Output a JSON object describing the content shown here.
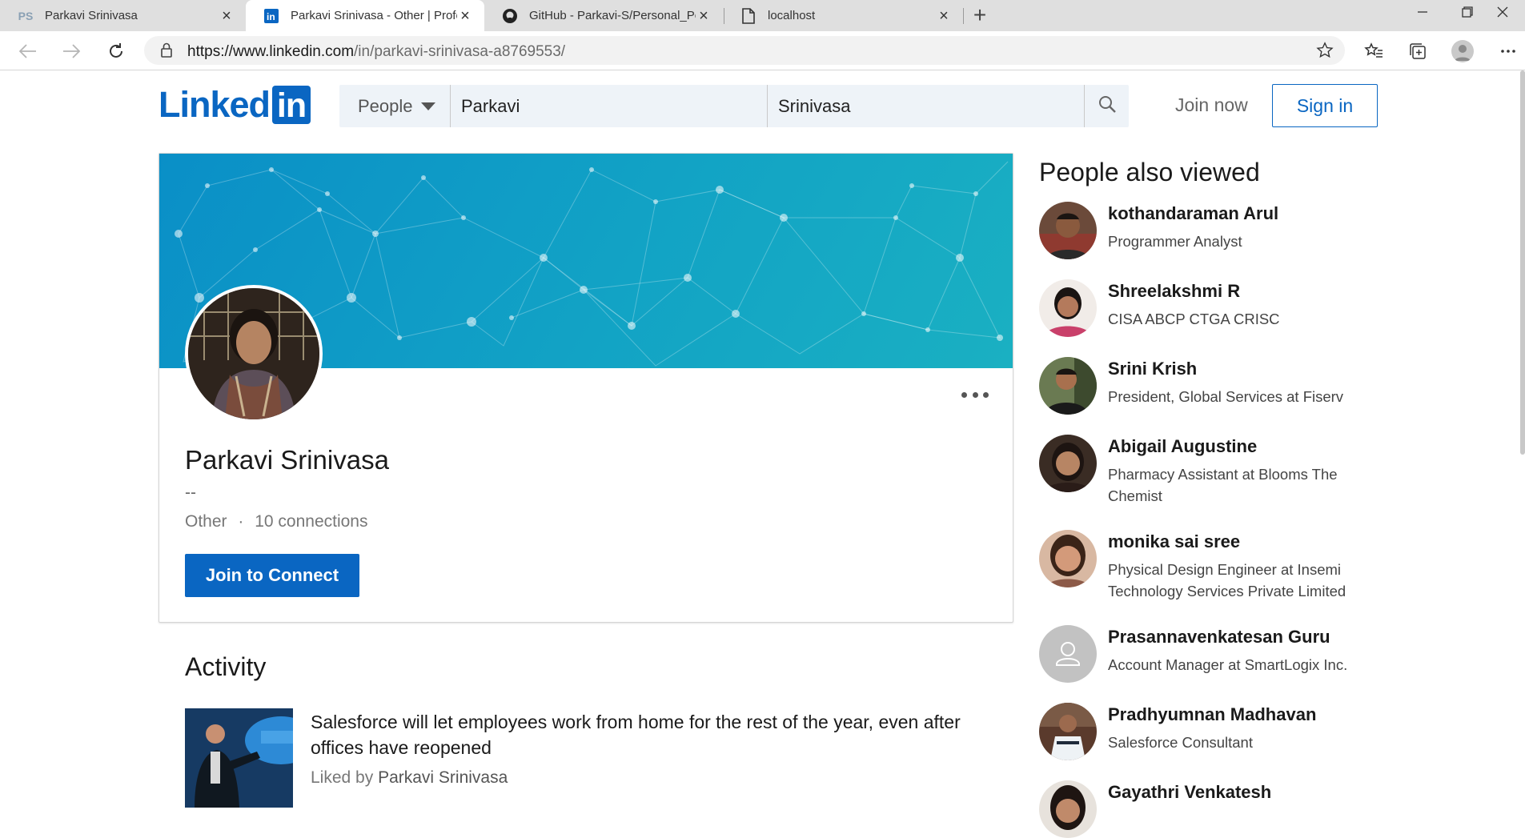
{
  "browser": {
    "tabs": [
      {
        "title": "Parkavi Srinivasa",
        "icon": "ps-monogram-icon"
      },
      {
        "title": "Parkavi Srinivasa - Other | Professional Profile | LinkedIn",
        "icon": "linkedin-icon",
        "active": true
      },
      {
        "title": "GitHub - Parkavi-S/Personal_Portfolio",
        "icon": "github-icon"
      },
      {
        "title": "localhost",
        "icon": "document-icon"
      }
    ],
    "tab_monogram": "PS",
    "url_host": "https://www.linkedin.com",
    "url_path": "/in/parkavi-srinivasa-a8769553/"
  },
  "linkedin": {
    "logo_text": "Linked",
    "logo_box": "in",
    "brand_color": "#0a66c2",
    "search": {
      "category": "People",
      "first_name": "Parkavi",
      "last_name": "Srinivasa"
    },
    "join_now": "Join now",
    "sign_in": "Sign in"
  },
  "profile": {
    "name": "Parkavi Srinivasa",
    "headline": "--",
    "industry": "Other",
    "separator": "·",
    "connections": "10 connections",
    "join_button": "Join to Connect"
  },
  "activity": {
    "heading": "Activity",
    "post_title": "Salesforce will let employees work from home for the rest of the year, even after offices have reopened",
    "liked_by_label": "Liked by",
    "liked_by_name": "Parkavi Srinivasa"
  },
  "people_also_viewed": {
    "heading": "People also viewed",
    "people": [
      {
        "name": "kothandaraman Arul",
        "title": "Programmer Analyst"
      },
      {
        "name": "Shreelakshmi R",
        "title": "CISA ABCP CTGA CRISC"
      },
      {
        "name": "Srini Krish",
        "title": "President, Global Services at Fiserv"
      },
      {
        "name": "Abigail Augustine",
        "title": "Pharmacy Assistant at Blooms The Chemist"
      },
      {
        "name": "monika sai sree",
        "title": "Physical Design Engineer at Insemi Technology Services Private Limited"
      },
      {
        "name": "Prasannavenkatesan Guru",
        "title": "Account Manager at SmartLogix Inc."
      },
      {
        "name": "Pradhyumnan Madhavan",
        "title": "Salesforce Consultant"
      },
      {
        "name": "Gayathri Venkatesh",
        "title": ""
      }
    ]
  }
}
